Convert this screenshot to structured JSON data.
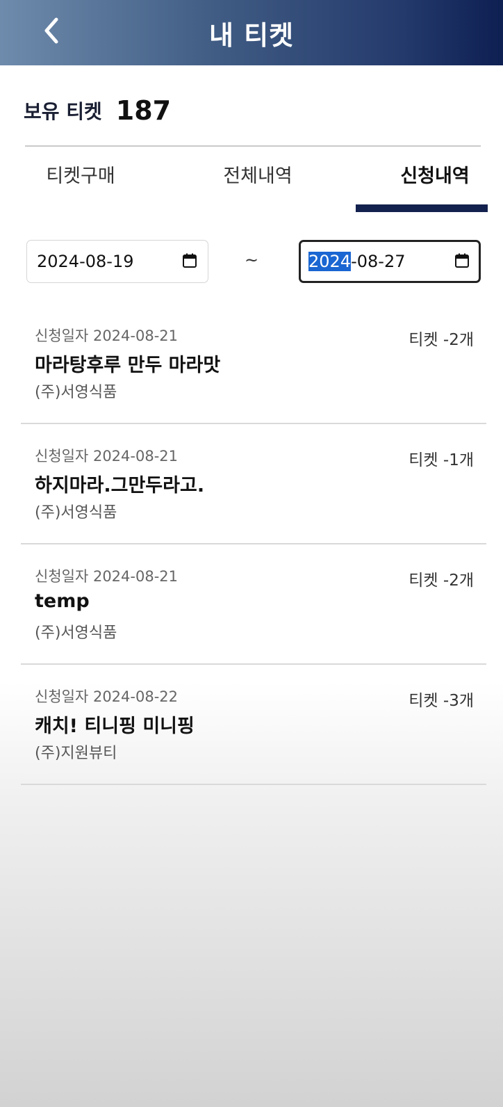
{
  "header": {
    "title": "내 티켓",
    "back_icon": "chevron-left-icon",
    "gradient_colors": [
      "#6e8bac",
      "#0e1f52"
    ]
  },
  "owned": {
    "label": "보유 티켓",
    "count": "187"
  },
  "tabs": [
    {
      "label": "티켓구매",
      "active": false
    },
    {
      "label": "전체내역",
      "active": false
    },
    {
      "label": "신청내역",
      "active": true
    }
  ],
  "filter": {
    "start_date": "2024-08-19",
    "separator": "~",
    "end_date_selected": "2024",
    "end_date_rest": "-08-27",
    "calendar_icon": "calendar-icon"
  },
  "items": [
    {
      "date_label": "신청일자 2024-08-21",
      "title": "마라탕후루 만두 마라맛",
      "company": "(주)서영식품",
      "count": "티켓 -2개"
    },
    {
      "date_label": "신청일자 2024-08-21",
      "title": "하지마라.그만두라고.",
      "company": "(주)서영식품",
      "count": "티켓 -1개"
    },
    {
      "date_label": "신청일자 2024-08-21",
      "title": "temp",
      "company": "(주)서영식품",
      "count": "티켓 -2개"
    },
    {
      "date_label": "신청일자 2024-08-22",
      "title": "캐치! 티니핑 미니핑",
      "company": "(주)지원뷰티",
      "count": "티켓 -3개"
    }
  ]
}
